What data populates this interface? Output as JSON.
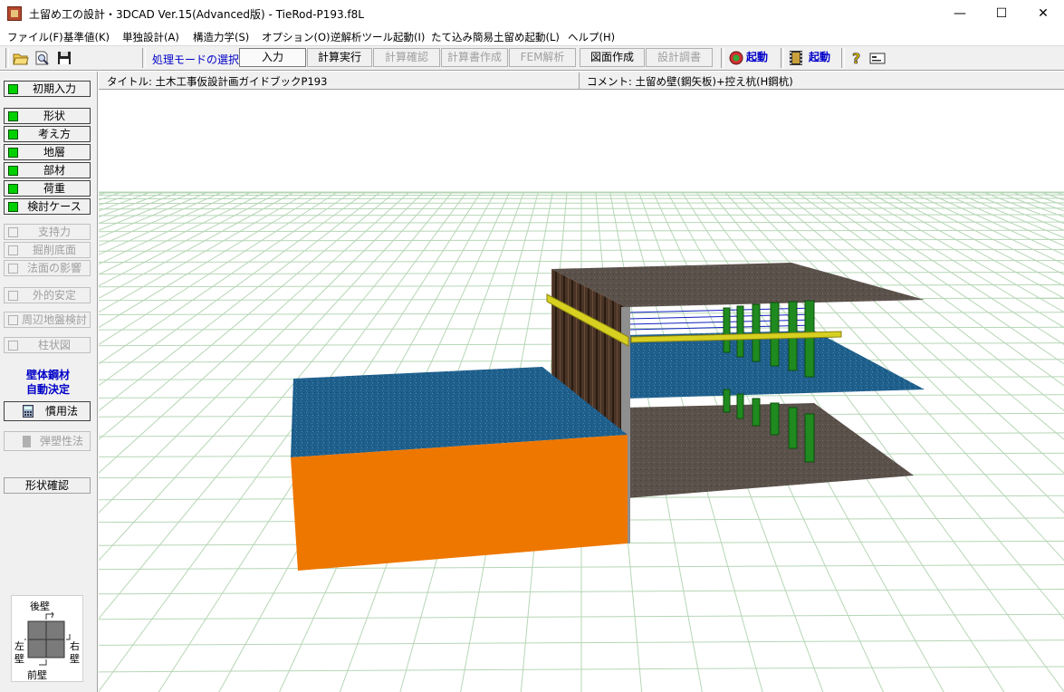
{
  "window": {
    "title": "土留め工の設計・3DCAD Ver.15(Advanced版) - TieRod-P193.f8L",
    "minimize": "—",
    "maximize": "☐",
    "close": "✕"
  },
  "menu": [
    "ファイル(F)",
    "基準値(K)",
    "単独設計(A)",
    "構造力学(S)",
    "オプション(O)",
    "逆解析ツール起動(I)",
    "たて込み簡易土留め起動(L)",
    "ヘルプ(H)"
  ],
  "toolbar": {
    "mode_label": "処理モードの選択",
    "buttons": [
      "入力",
      "計算実行",
      "計算確認",
      "計算書作成",
      "FEM解析",
      "図面作成",
      "設計調書"
    ],
    "launch1": "起動",
    "launch2": "起動",
    "icons": [
      "open-folder-icon",
      "search-file-icon",
      "save-icon",
      "app-launch-icon",
      "film-launch-icon",
      "help-icon",
      "card-icon"
    ]
  },
  "info": {
    "title": "タイトル: 土木工事仮設計画ガイドブックP193",
    "comment": "コメント: 土留め壁(鋼矢板)+控え杭(H鋼杭)"
  },
  "sidebar": {
    "initial": "初期入力",
    "group1": [
      "形状",
      "考え方",
      "地層",
      "部材",
      "荷重",
      "検討ケース"
    ],
    "group2": [
      "支持力",
      "掘削底面",
      "法面の影響"
    ],
    "external": "外的安定",
    "surrounding": "周辺地盤検討",
    "column": "柱状図",
    "auto_line1": "壁体鋼材",
    "auto_line2": "自動決定",
    "conventional": "慣用法",
    "elastoplastic": "弾塑性法",
    "shape_check": "形状確認"
  },
  "compass": {
    "back": "後壁",
    "front": "前壁",
    "left1": "左",
    "left2": "壁",
    "right1": "右",
    "right2": "壁"
  },
  "colors": {
    "led_on": "#00d000",
    "accent_blue": "#0000c8",
    "water": "#1f5f8c",
    "orange_ground": "#ee7700",
    "soil": "#5a4f48",
    "piles": "#1f8a1f",
    "wall": "#4a3426",
    "tie_rod": "#d8d020",
    "grid": "#b8d8b8"
  }
}
